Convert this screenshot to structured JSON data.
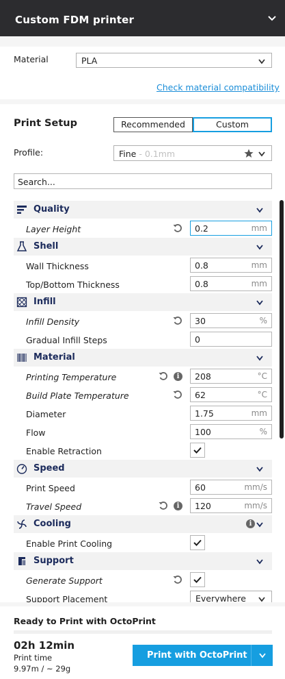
{
  "header": {
    "title": "Custom FDM printer"
  },
  "material": {
    "label": "Material",
    "value": "PLA",
    "compat_link": "Check material compatibility"
  },
  "setup": {
    "title": "Print Setup",
    "tab_recommended": "Recommended",
    "tab_custom": "Custom",
    "profile_label": "Profile:",
    "profile_name": "Fine",
    "profile_detail": " - 0.1mm",
    "search_placeholder": "Search..."
  },
  "sections": {
    "quality": {
      "title": "Quality",
      "layer_height": {
        "label": "Layer Height",
        "value": "0.2",
        "unit": "mm"
      }
    },
    "shell": {
      "title": "Shell",
      "wall_thickness": {
        "label": "Wall Thickness",
        "value": "0.8",
        "unit": "mm"
      },
      "top_bottom": {
        "label": "Top/Bottom Thickness",
        "value": "0.8",
        "unit": "mm"
      }
    },
    "infill": {
      "title": "Infill",
      "density": {
        "label": "Infill Density",
        "value": "30",
        "unit": "%"
      },
      "gradual": {
        "label": "Gradual Infill Steps",
        "value": "0"
      }
    },
    "material": {
      "title": "Material",
      "print_temp": {
        "label": "Printing Temperature",
        "value": "208",
        "unit": "°C"
      },
      "plate_temp": {
        "label": "Build Plate Temperature",
        "value": "62",
        "unit": "°C"
      },
      "diameter": {
        "label": "Diameter",
        "value": "1.75",
        "unit": "mm"
      },
      "flow": {
        "label": "Flow",
        "value": "100",
        "unit": "%"
      },
      "retraction": {
        "label": "Enable Retraction",
        "checked": true
      }
    },
    "speed": {
      "title": "Speed",
      "print_speed": {
        "label": "Print Speed",
        "value": "60",
        "unit": "mm/s"
      },
      "travel_speed": {
        "label": "Travel Speed",
        "value": "120",
        "unit": "mm/s"
      }
    },
    "cooling": {
      "title": "Cooling",
      "enable": {
        "label": "Enable Print Cooling",
        "checked": true
      }
    },
    "support": {
      "title": "Support",
      "generate": {
        "label": "Generate Support",
        "checked": true
      },
      "placement": {
        "label": "Support Placement",
        "value": "Everywhere"
      }
    }
  },
  "bottom": {
    "ready_text": "Ready to Print with OctoPrint",
    "time": "02h 12min",
    "time_label": "Print time",
    "material_usage": "9.97m / ~ 29g",
    "print_button": "Print with OctoPrint"
  },
  "colors": {
    "accent": "#169ee0",
    "header_bg": "#2c2c2f",
    "section_title": "#1b2a5b"
  },
  "icons": [
    "chevron-down-icon",
    "star-icon",
    "reset-icon",
    "info-icon",
    "quality-icon",
    "shell-icon",
    "infill-icon",
    "material-icon",
    "speed-icon",
    "cooling-icon",
    "support-icon",
    "checkmark-icon"
  ]
}
